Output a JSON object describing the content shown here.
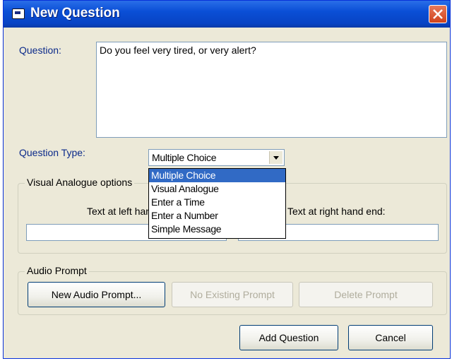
{
  "window": {
    "title": "New Question"
  },
  "question": {
    "label": "Question:",
    "value": "Do you feel very tired, or very alert?"
  },
  "question_type": {
    "label": "Question Type:",
    "selected": "Multiple Choice",
    "options": [
      "Multiple Choice",
      "Visual Analogue",
      "Enter a Time",
      "Enter a Number",
      "Simple Message"
    ]
  },
  "visual_analogue": {
    "legend": "Visual Analogue options",
    "left_label": "Text at left hand end:",
    "right_label": "Text at right hand end:",
    "left_value": "",
    "right_value": ""
  },
  "audio_prompt": {
    "legend": "Audio Prompt",
    "new_button": "New Audio Prompt...",
    "existing_button": "No Existing Prompt",
    "delete_button": "Delete Prompt"
  },
  "actions": {
    "add_button": "Add Question",
    "cancel_button": "Cancel"
  },
  "colors": {
    "title_bar": "#0a4fd6",
    "selection": "#316ac5",
    "label_text": "#0b2a8a",
    "close_button": "#d0421b"
  }
}
